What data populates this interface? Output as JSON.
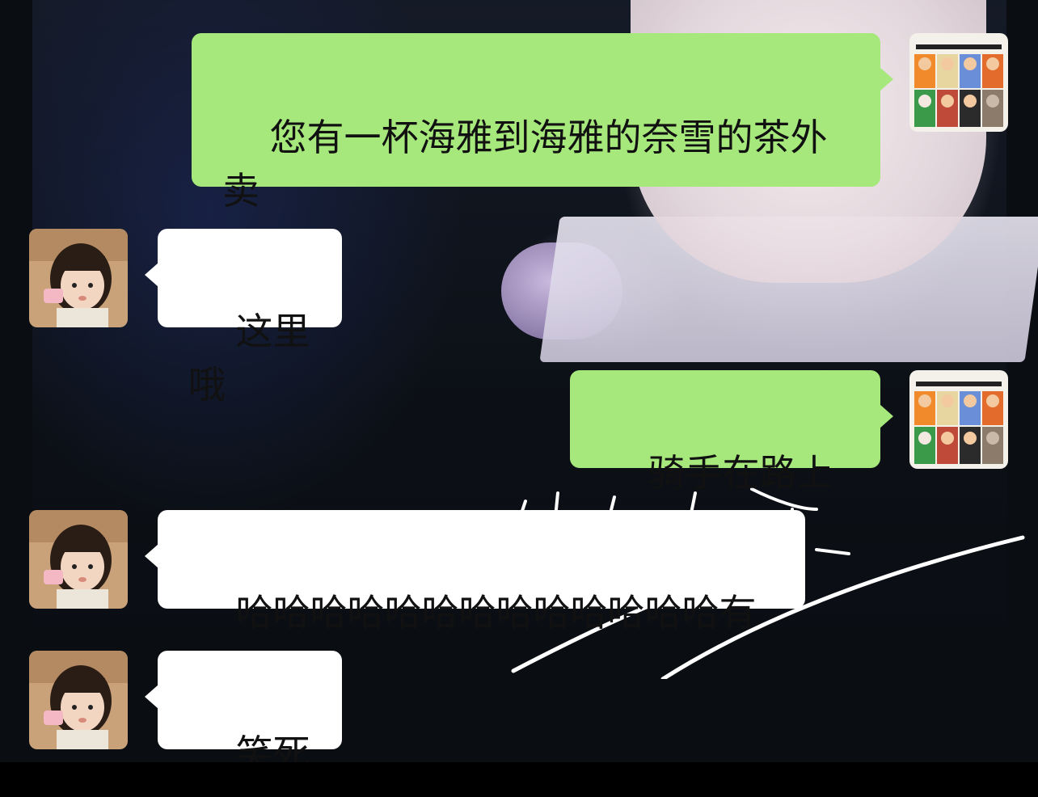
{
  "chat": {
    "messages": [
      {
        "side": "out",
        "text": "您有一杯海雅到海雅的奈雪的茶外卖",
        "avatar": "comic-avatar"
      },
      {
        "side": "in",
        "text": "这里哦",
        "avatar": "girl-avatar"
      },
      {
        "side": "out",
        "text": "骑手在路上了",
        "avatar": "comic-avatar"
      },
      {
        "side": "in",
        "text": "哈哈哈哈哈哈哈哈哈哈哈哈哈有",
        "avatar": "girl-avatar"
      },
      {
        "side": "in",
        "text": "笑死了",
        "avatar": "girl-avatar"
      }
    ]
  },
  "colors": {
    "outgoing_bubble": "#a6e87c",
    "incoming_bubble": "#ffffff",
    "text": "#111111"
  }
}
